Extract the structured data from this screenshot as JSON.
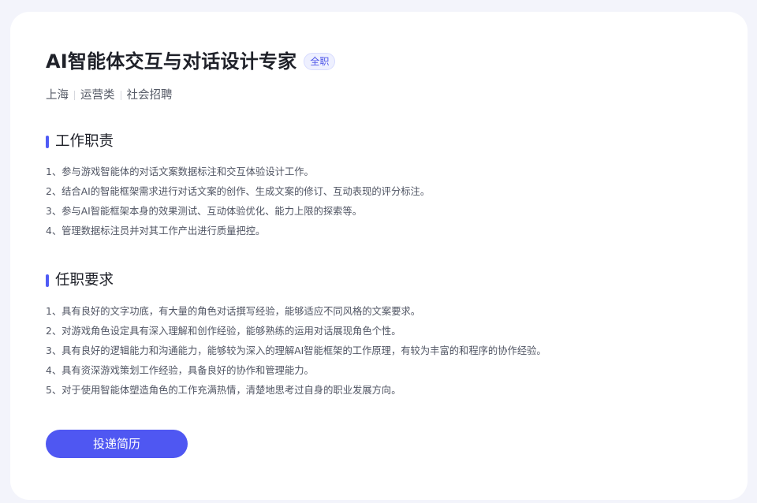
{
  "job": {
    "title": "AI智能体交互与对话设计专家",
    "badge": "全职",
    "meta": [
      "上海",
      "运营类",
      "社会招聘"
    ]
  },
  "sections": [
    {
      "title": "工作职责",
      "items": [
        "1、参与游戏智能体的对话文案数据标注和交互体验设计工作。",
        "2、结合AI的智能框架需求进行对话文案的创作、生成文案的修订、互动表现的评分标注。",
        "3、参与AI智能框架本身的效果测试、互动体验优化、能力上限的探索等。",
        "4、管理数据标注员并对其工作产出进行质量把控。"
      ]
    },
    {
      "title": "任职要求",
      "items": [
        "1、具有良好的文字功底，有大量的角色对话撰写经验，能够适应不同风格的文案要求。",
        "2、对游戏角色设定具有深入理解和创作经验，能够熟练的运用对话展现角色个性。",
        "3、具有良好的逻辑能力和沟通能力，能够较为深入的理解AI智能框架的工作原理，有较为丰富的和程序的协作经验。",
        "4、具有资深游戏策划工作经验，具备良好的协作和管理能力。",
        "5、对于使用智能体塑造角色的工作充满热情，清楚地思考过自身的职业发展方向。"
      ]
    }
  ],
  "actions": {
    "apply_label": "投递简历"
  },
  "colors": {
    "accent": "#4f57f2",
    "badge_bg": "#eef0ff",
    "page_bg": "#f3f4fb"
  }
}
